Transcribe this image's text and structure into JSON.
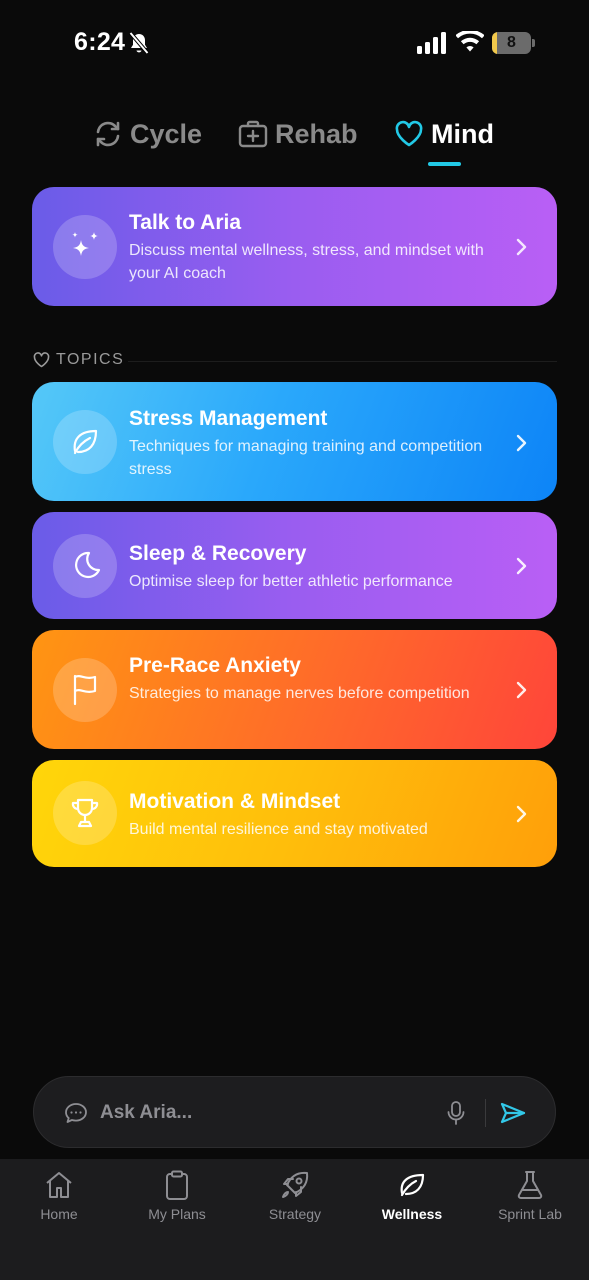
{
  "status_bar": {
    "time": "6:24",
    "battery_level": "8",
    "battery_fraction": 0.08
  },
  "tabs": [
    {
      "label": "Cycle",
      "icon": "refresh-cycle-icon",
      "active": false
    },
    {
      "label": "Rehab",
      "icon": "medical-kit-icon",
      "active": false
    },
    {
      "label": "Mind",
      "icon": "heart-icon",
      "active": true
    }
  ],
  "aria_card": {
    "title": "Talk to Aria",
    "description": "Discuss mental wellness, stress, and mindset with your AI coach",
    "icon": "sparkles-icon"
  },
  "topics": {
    "header": "TOPICS",
    "items": [
      {
        "title": "Stress Management",
        "description": "Techniques for managing training and competition stress",
        "icon": "leaf-icon"
      },
      {
        "title": "Sleep & Recovery",
        "description": "Optimise sleep for better athletic performance",
        "icon": "moon-icon"
      },
      {
        "title": "Pre-Race Anxiety",
        "description": "Strategies to manage nerves before competition",
        "icon": "flag-icon"
      },
      {
        "title": "Motivation & Mindset",
        "description": "Build mental resilience and stay motivated",
        "icon": "trophy-icon"
      }
    ]
  },
  "ask_bar": {
    "placeholder": "Ask Aria..."
  },
  "bottom_nav": [
    {
      "label": "Home",
      "icon": "home-icon",
      "active": false
    },
    {
      "label": "My Plans",
      "icon": "clipboard-icon",
      "active": false
    },
    {
      "label": "Strategy",
      "icon": "rocket-icon",
      "active": false
    },
    {
      "label": "Wellness",
      "icon": "leaf-icon",
      "active": true
    },
    {
      "label": "Sprint Lab",
      "icon": "flask-icon",
      "active": false
    }
  ],
  "colors": {
    "background": "#0a0a0a",
    "accent_cyan": "#22c9e6",
    "send_cyan": "#32c8e8",
    "inactive_gray": "#8a8a8a"
  }
}
